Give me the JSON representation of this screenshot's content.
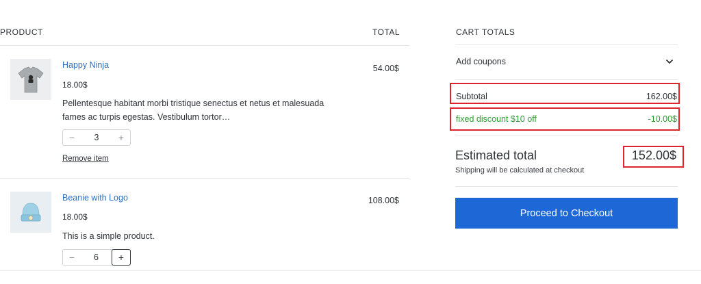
{
  "cart": {
    "headers": {
      "product": "PRODUCT",
      "total": "TOTAL"
    },
    "items": [
      {
        "name": "Happy Ninja",
        "unit_price": "18.00$",
        "description": "Pellentesque habitant morbi tristique senectus et netus et malesuada fames ac turpis egestas. Vestibulum tortor…",
        "minus": "−",
        "quantity": "3",
        "plus": "+",
        "remove_label": "Remove item",
        "line_total": "54.00$",
        "icon": "tshirt-icon"
      },
      {
        "name": "Beanie with Logo",
        "unit_price": "18.00$",
        "description": "This is a simple product.",
        "minus": "−",
        "quantity": "6",
        "plus": "+",
        "line_total": "108.00$",
        "icon": "beanie-icon"
      }
    ]
  },
  "totals": {
    "title": "CART TOTALS",
    "coupons_label": "Add coupons",
    "subtotal_label": "Subtotal",
    "subtotal_value": "162.00$",
    "discount_label": "fixed discount $10 off",
    "discount_value": "-10.00$",
    "estimated_label": "Estimated total",
    "estimated_value": "152.00$",
    "shipping_note": "Shipping will be calculated at checkout",
    "checkout_label": "Proceed to Checkout"
  },
  "colors": {
    "link": "#2f6fbf",
    "discount": "#2e9e2e",
    "checkout_bg": "#1e67d6",
    "highlight": "#e0222a"
  }
}
